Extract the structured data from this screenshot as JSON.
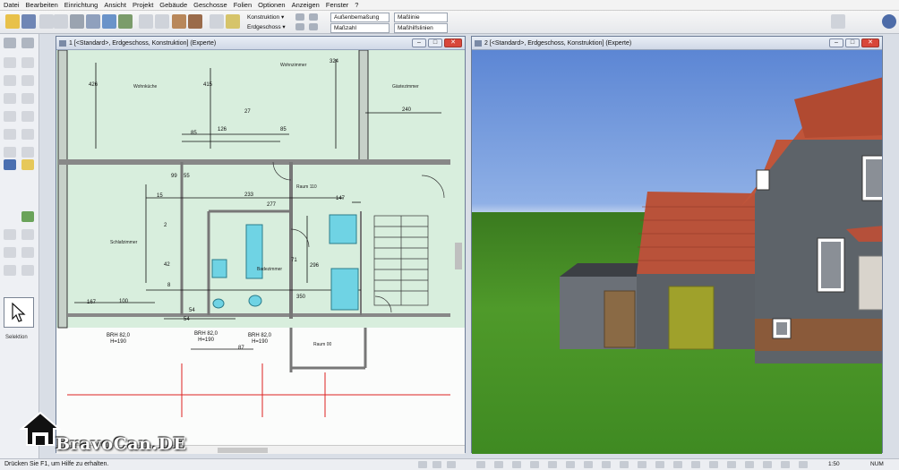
{
  "menu": [
    "Datei",
    "Bearbeiten",
    "Einrichtung",
    "Ansicht",
    "Projekt",
    "Gebäude",
    "Geschosse",
    "Folien",
    "Optionen",
    "Anzeigen",
    "Fenster",
    "?"
  ],
  "toolbar": {
    "layer_combo": "Konstruktion",
    "floor_combo": "Erdgeschoss",
    "field1": "Außenbemaßung",
    "field2": "Maßlinie",
    "field3": "Maßzahl",
    "field4": "Maßhilfslinien"
  },
  "palette": {
    "selection_label": "Selektion"
  },
  "windows": {
    "plan_title": "1 [<Standard>, Erdgeschoss, Konstruktion] (Experte)",
    "view3d_title": "2 [<Standard>, Erdgeschoss, Konstruktion] (Experte)"
  },
  "plan": {
    "rooms": [
      "Wohnzimmer",
      "Wohnküche",
      "Gästezimmer",
      "Schlafzimmer",
      "Badezimmer",
      "Raum 110",
      "Raum 00"
    ],
    "dimensions": [
      "426",
      "27",
      "415",
      "324",
      "240",
      "85",
      "126",
      "85",
      "99",
      "55",
      "15",
      "233",
      "147",
      "277",
      "71",
      "2",
      "54",
      "42",
      "350",
      "296",
      "100",
      "167",
      "8",
      "87",
      "54"
    ],
    "brh": [
      {
        "label": "BRH 82,0",
        "h": "H=190"
      },
      {
        "label": "BRH 82,0",
        "h": "H=190"
      },
      {
        "label": "BRH 82,0",
        "h": "H=190"
      }
    ]
  },
  "status": {
    "hint": "Drücken Sie F1, um Hilfe zu erhalten.",
    "coords": "1:50",
    "num": "NUM"
  },
  "watermark": "BravoCan.DE",
  "colors": {
    "plan_bg": "#d8eedd",
    "sky": "#6f97dc",
    "grass": "#4a9127",
    "roof": "#b54a33",
    "wall_dark": "#5d6369",
    "door_yellow": "#9fa12b"
  }
}
